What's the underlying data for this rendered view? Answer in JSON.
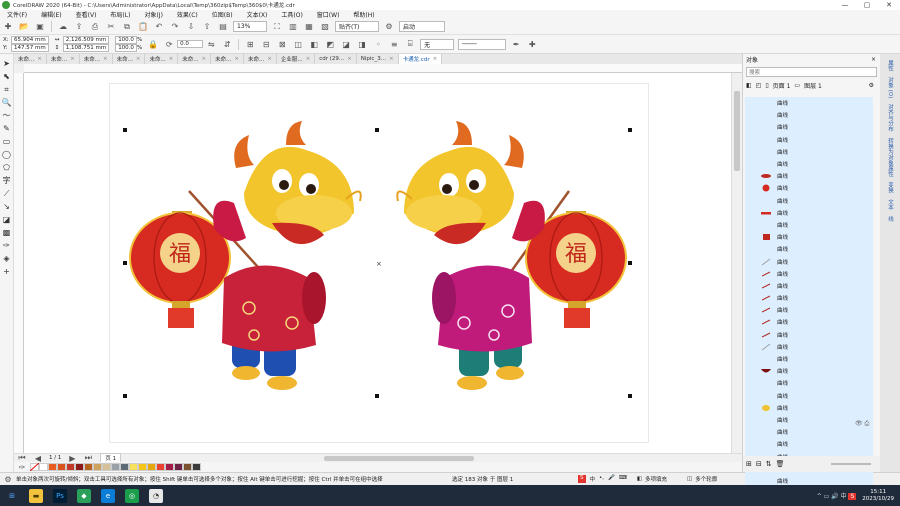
{
  "window": {
    "title": "CorelDRAW 2020 (64-Bit) - C:\\Users\\Administrator\\AppData\\Local\\Temp\\360zip$Temp\\360$0\\卡通龙.cdr"
  },
  "menu": [
    "文件(F)",
    "编辑(E)",
    "查看(V)",
    "布局(L)",
    "对象(J)",
    "效果(C)",
    "位图(B)",
    "文本(X)",
    "工具(O)",
    "窗口(W)",
    "帮助(H)"
  ],
  "toolbar": {
    "zoom": "13%",
    "snap": "贴齐(T)",
    "launch": "启动"
  },
  "propbar": {
    "x": "65.904 mm",
    "y": "147.57 mm",
    "w": "2,126.509 mm",
    "h": "1,108.751 mm",
    "sx": "100.0",
    "sy": "100.0",
    "pct": "%",
    "angle": "0.0",
    "fill_none": "无"
  },
  "doc_tabs": [
    {
      "label": "未命...",
      "active": false
    },
    {
      "label": "未命...",
      "active": false
    },
    {
      "label": "未命...",
      "active": false
    },
    {
      "label": "未命...",
      "active": false
    },
    {
      "label": "未命...",
      "active": false
    },
    {
      "label": "未命...",
      "active": false
    },
    {
      "label": "未命...",
      "active": false
    },
    {
      "label": "未命...",
      "active": false
    },
    {
      "label": "企业服...",
      "active": false
    },
    {
      "label": "cdr (29...",
      "active": false
    },
    {
      "label": "Nipic_3...",
      "active": false
    },
    {
      "label": "卡通龙.cdr",
      "active": true
    }
  ],
  "pagebar": {
    "page_label": "页 1"
  },
  "palette": [
    "#ffffff",
    "#e85d20",
    "#d9531e",
    "#c0392b",
    "#8b1a1a",
    "#b5651d",
    "#cfa35e",
    "#d4c19a",
    "#9aa2a8",
    "#5e6a73",
    "#f6e05e",
    "#f5c518",
    "#e4a70c",
    "#e8432f",
    "#a31c48",
    "#6b2346",
    "#7a5230",
    "#3b3b3b"
  ],
  "status": {
    "hint": "单击对象两次可旋转/倾斜；双击工具可选择所有对象；按住 Shift 键单击可选择多个对象；按住 Alt 键单击可进行挖掘；按住 Ctrl 并单击可在组中选择",
    "selection": "选定 183 对象 于 图层 1",
    "fill_label": "多项填充",
    "outline_label": "多个轮廓"
  },
  "docker": {
    "title": "对象",
    "search_placeholder": "搜索",
    "page": "页面 1",
    "layer": "图层 1",
    "items": [
      "曲线",
      "曲线",
      "曲线",
      "曲线",
      "曲线",
      "曲线",
      "曲线",
      "曲线",
      "曲线",
      "曲线",
      "曲线",
      "曲线",
      "曲线",
      "曲线",
      "曲线",
      "曲线",
      "曲线",
      "曲线",
      "曲线",
      "曲线",
      "曲线",
      "曲线",
      "曲线",
      "曲线",
      "曲线",
      "曲线",
      "曲线",
      "曲线",
      "曲线",
      "曲线",
      "曲线",
      "曲线"
    ],
    "thumbs": [
      "none",
      "none",
      "none",
      "none",
      "none",
      "none",
      "red-oval",
      "red-dot",
      "none",
      "red-dash",
      "none",
      "red-square",
      "none",
      "line",
      "red-line",
      "red-line",
      "red-line",
      "red-line",
      "red-line",
      "red-line",
      "line",
      "none",
      "red-bowl",
      "none",
      "none",
      "yellow-blob",
      "none",
      "none",
      "none",
      "none",
      "none",
      "none"
    ]
  },
  "vtabs": [
    "属性",
    "对象 (O)",
    "对齐与分布",
    "转换为对象属性",
    "变换",
    "文本",
    "线"
  ],
  "taskbar": {
    "time": "15:11",
    "date": "2023/10/29"
  },
  "icons": {
    "select": "pointer-icon",
    "lantern_text": "福"
  }
}
